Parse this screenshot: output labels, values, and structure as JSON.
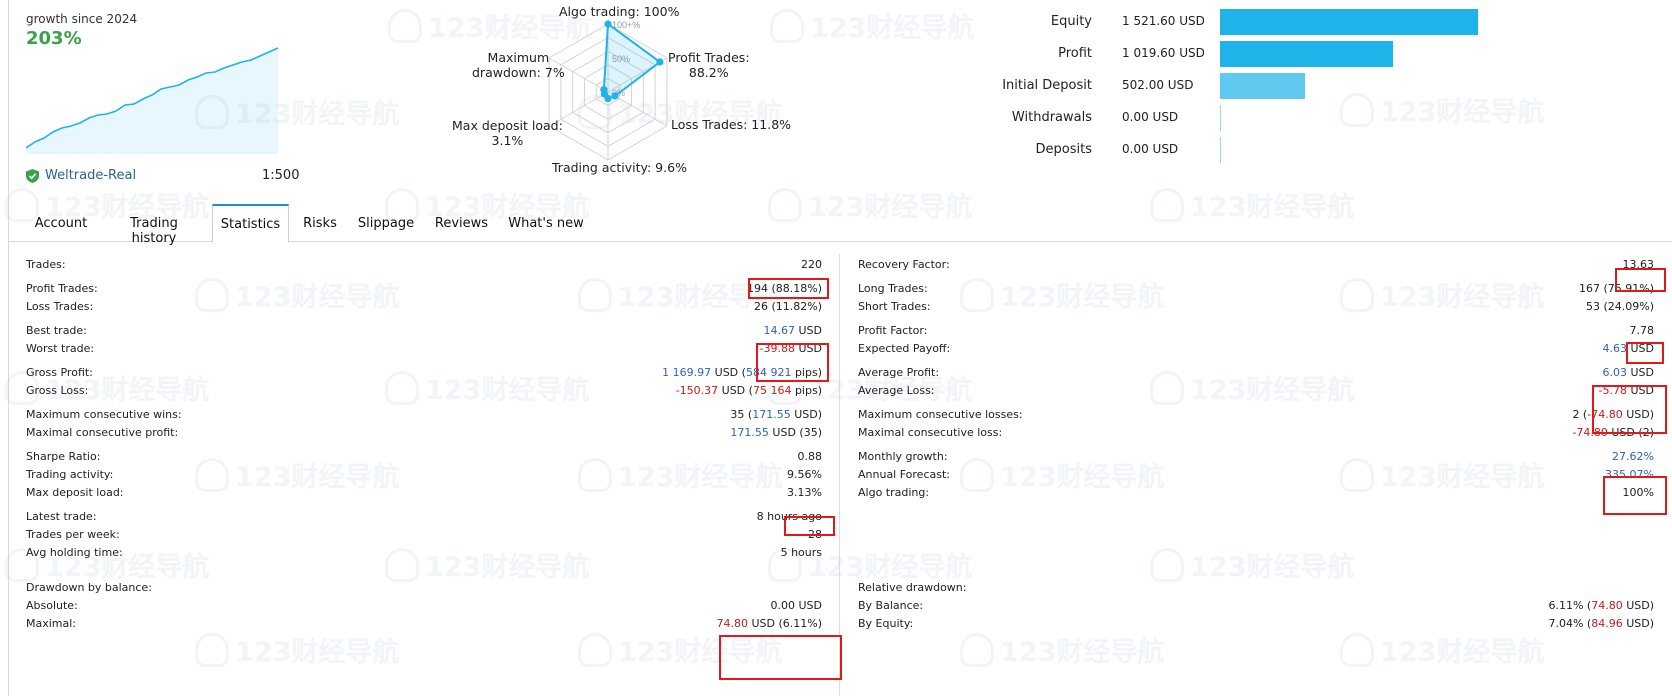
{
  "growth": {
    "label": "growth since 2024",
    "value": "203%",
    "account": "Weltrade-Real",
    "leverage": "1:500",
    "series": [
      0.0,
      0.06,
      0.1,
      0.16,
      0.2,
      0.22,
      0.25,
      0.3,
      0.33,
      0.34,
      0.37,
      0.43,
      0.44,
      0.49,
      0.53,
      0.59,
      0.61,
      0.63,
      0.68,
      0.71,
      0.75,
      0.76,
      0.8,
      0.83,
      0.86,
      0.88,
      0.92,
      0.96,
      1.0
    ]
  },
  "radar": {
    "labels": {
      "algo": "Algo trading: 100%",
      "profit1": "Profit Trades:",
      "profit2": "88.2%",
      "loss": "Loss Trades: 11.8%",
      "activity": "Trading activity: 9.6%",
      "deposit1": "Max deposit load:",
      "deposit2": "3.1%",
      "dd1": "Maximum",
      "dd2": "drawdown: 7%"
    },
    "ticks": [
      "100+%",
      "50%",
      "0%"
    ],
    "values": [
      100,
      88.2,
      11.8,
      9.6,
      3.1,
      7
    ],
    "color": "#1fb3ea"
  },
  "balance": {
    "rows": [
      {
        "label": "Equity",
        "value": "1 521.60 USD",
        "amount": 1521.6
      },
      {
        "label": "Profit",
        "value": "1 019.60 USD",
        "amount": 1019.6
      },
      {
        "label": "Initial Deposit",
        "value": "502.00 USD",
        "amount": 502.0
      },
      {
        "label": "Withdrawals",
        "value": "0.00 USD",
        "amount": 0
      },
      {
        "label": "Deposits",
        "value": "0.00 USD",
        "amount": 0
      }
    ]
  },
  "tabs": [
    "Account",
    "Trading history",
    "Statistics",
    "Risks",
    "Slippage",
    "Reviews",
    "What's new"
  ],
  "active_tab": "Statistics",
  "left": {
    "trades": {
      "label": "Trades:",
      "value": "220"
    },
    "profit_trades": {
      "label": "Profit Trades:",
      "value": "194 (88.18%)"
    },
    "loss_trades": {
      "label": "Loss Trades:",
      "value": "26 (11.82%)"
    },
    "best_trade": {
      "label": "Best trade:",
      "num": "14.67",
      "unit": " USD"
    },
    "worst_trade": {
      "label": "Worst trade:",
      "num": "-39.88",
      "unit": " USD"
    },
    "gross_profit": {
      "label": "Gross Profit:",
      "num": "1 169.97",
      "mid": " USD (",
      "pips": "584 921",
      "tail": " pips)"
    },
    "gross_loss": {
      "label": "Gross Loss:",
      "num": "-150.37",
      "mid": " USD (",
      "pips": "75 164",
      "tail": " pips)"
    },
    "max_cons_wins": {
      "label": "Maximum consecutive wins:",
      "pre": "35 (",
      "num": "171.55",
      "tail": " USD)"
    },
    "maximal_cons_profit": {
      "label": "Maximal consecutive profit:",
      "num": "171.55",
      "tail": " USD (35)"
    },
    "sharpe": {
      "label": "Sharpe Ratio:",
      "value": "0.88"
    },
    "trading_activity": {
      "label": "Trading activity:",
      "value": "9.56%"
    },
    "max_deposit_load": {
      "label": "Max deposit load:",
      "value": "3.13%"
    },
    "latest_trade": {
      "label": "Latest trade:",
      "value": "8 hours ago"
    },
    "trades_per_week": {
      "label": "Trades per week:",
      "value": "28"
    },
    "avg_holding": {
      "label": "Avg holding time:",
      "value": "5 hours"
    },
    "drawdown_title": "Drawdown by balance:",
    "absolute": {
      "label": "Absolute:",
      "value": "0.00 USD"
    },
    "maximal": {
      "label": "Maximal:",
      "num": "74.80",
      "tail": " USD (6.11%)"
    }
  },
  "right": {
    "recovery": {
      "label": "Recovery Factor:",
      "value": "13.63"
    },
    "long_trades": {
      "label": "Long Trades:",
      "value": "167 (75.91%)"
    },
    "short_trades": {
      "label": "Short Trades:",
      "value": "53 (24.09%)"
    },
    "profit_factor": {
      "label": "Profit Factor:",
      "value": "7.78"
    },
    "expected_payoff": {
      "label": "Expected Payoff:",
      "num": "4.63",
      "unit": " USD"
    },
    "avg_profit": {
      "label": "Average Profit:",
      "num": "6.03",
      "unit": " USD"
    },
    "avg_loss": {
      "label": "Average Loss:",
      "num": "-5.78",
      "unit": " USD"
    },
    "max_cons_losses": {
      "label": "Maximum consecutive losses:",
      "pre": "2 (",
      "num": "-74.80",
      "tail": " USD)"
    },
    "maximal_cons_loss": {
      "label": "Maximal consecutive loss:",
      "num": "-74.80",
      "tail": " USD (2)"
    },
    "monthly_growth": {
      "label": "Monthly growth:",
      "value": "27.62%"
    },
    "annual_forecast": {
      "label": "Annual Forecast:",
      "value": "335.07%"
    },
    "algo_trading": {
      "label": "Algo trading:",
      "value": "100%"
    },
    "relative_title": "Relative drawdown:",
    "by_balance": {
      "label": "By Balance:",
      "pre": "6.11% (",
      "num": "74.80",
      "tail": " USD)"
    },
    "by_equity": {
      "label": "By Equity:",
      "pre": "7.04% (",
      "num": "84.96",
      "tail": " USD)"
    }
  },
  "watermark": "123财经导航",
  "colors": {
    "accent": "#1fb3ea",
    "positive": "#3aa34a",
    "link": "#2d5f99",
    "negative": "#c21b1b",
    "highlight": "#e31919"
  }
}
